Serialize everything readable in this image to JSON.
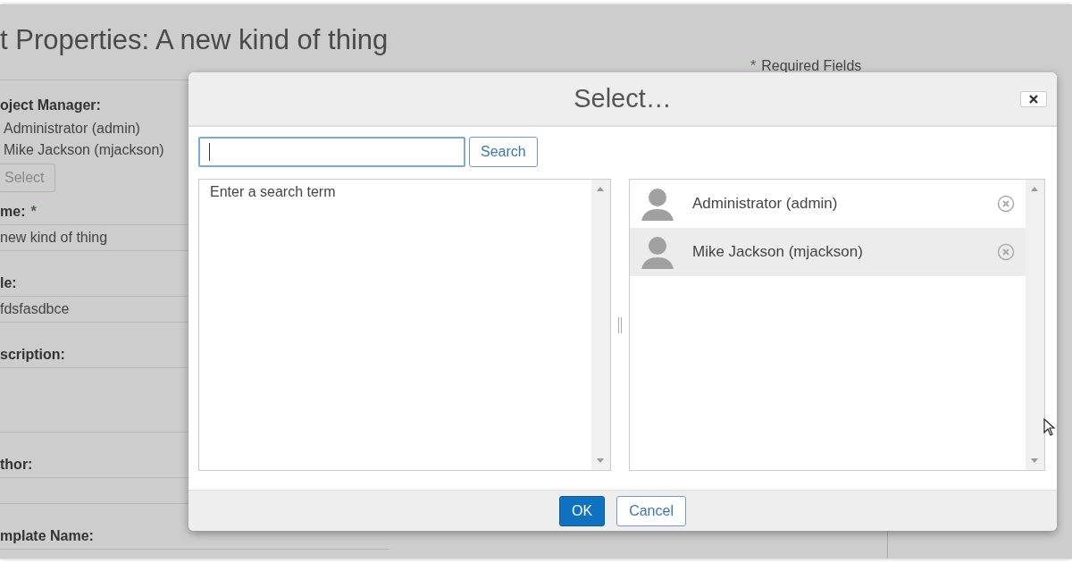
{
  "page": {
    "title": "t Properties: A new kind of thing",
    "required_note": {
      "mark": "*",
      "text": "Required Fields"
    },
    "fields": [
      {
        "kind": "people",
        "label": "oject Manager:",
        "values": [
          "Administrator (admin)",
          "Mike Jackson (mjackson)"
        ],
        "button": {
          "label": "Select",
          "disabled": true
        }
      },
      {
        "kind": "text",
        "label": "me:",
        "required_mark": "*",
        "value": "new kind of thing"
      },
      {
        "kind": "text",
        "label": "le:",
        "value": "fdsfasdbce"
      },
      {
        "kind": "textarea",
        "label": "scription:"
      },
      {
        "kind": "text",
        "label": "thor:"
      },
      {
        "kind": "text",
        "label": "mplate Name:"
      }
    ]
  },
  "dialog": {
    "title": "Select…",
    "search": {
      "focused": true,
      "button": "Search"
    },
    "results": {
      "message": "Enter a search term"
    },
    "chosen": [
      {
        "name": "Administrator (admin)",
        "selected": false
      },
      {
        "name": "Mike Jackson (mjackson)",
        "selected": true
      }
    ],
    "buttons": [
      {
        "label": "OK",
        "kind": "primary"
      },
      {
        "label": "Cancel",
        "kind": "secondary"
      }
    ]
  }
}
